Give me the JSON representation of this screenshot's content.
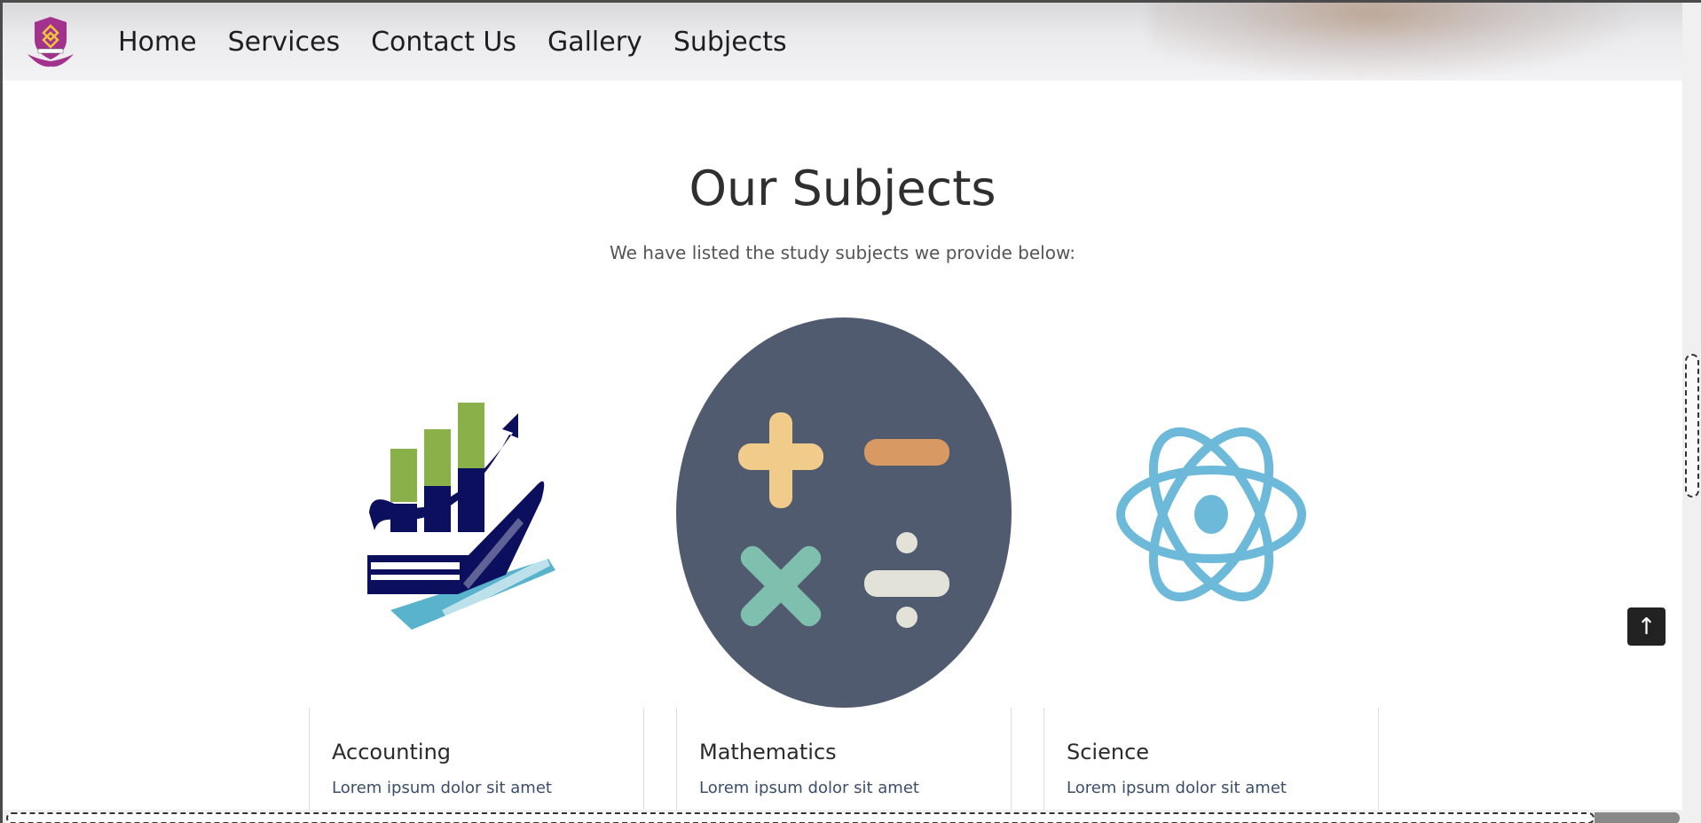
{
  "nav": {
    "items": [
      {
        "label": "Home"
      },
      {
        "label": "Services"
      },
      {
        "label": "Contact Us"
      },
      {
        "label": "Gallery"
      },
      {
        "label": "Subjects"
      }
    ]
  },
  "section": {
    "title": "Our Subjects",
    "subtitle": "We have listed the study subjects we provide below:"
  },
  "subjects": [
    {
      "name": "Accounting",
      "desc": "Lorem ipsum dolor sit amet",
      "icon": "accounting-books-chart-icon"
    },
    {
      "name": "Mathematics",
      "desc": "Lorem ipsum dolor sit amet",
      "icon": "math-operators-icon"
    },
    {
      "name": "Science",
      "desc": "Lorem ipsum dolor sit amet",
      "icon": "atom-icon"
    }
  ],
  "back_to_top": {
    "icon": "arrow-up-icon",
    "glyph": "↑"
  },
  "colors": {
    "logo": "#a2328c",
    "accounting_navy": "#0c0f5e",
    "accounting_green": "#8ab04a",
    "accounting_blue": "#5ab3cc",
    "math_bg": "#515b70",
    "plus": "#f1cb8a",
    "minus": "#d89a62",
    "times": "#7fbfad",
    "divide": "#e2e2d8",
    "atom": "#6db9da"
  }
}
